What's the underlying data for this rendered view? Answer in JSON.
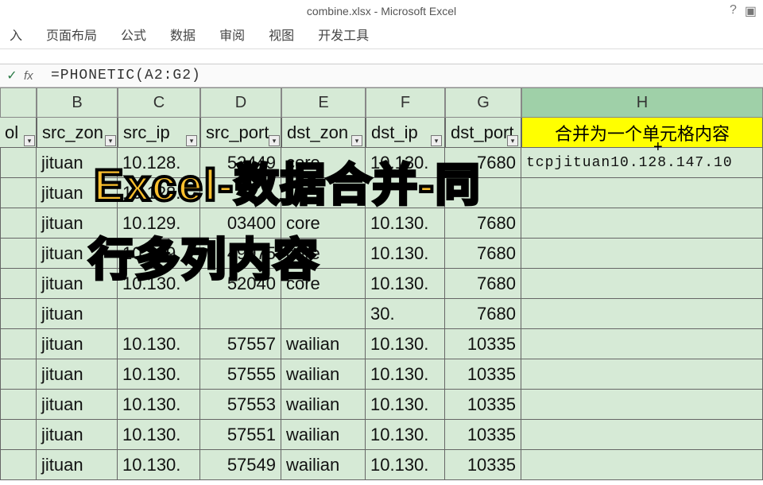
{
  "window": {
    "title": "combine.xlsx - Microsoft Excel"
  },
  "ribbon": {
    "tabs": [
      "入",
      "页面布局",
      "公式",
      "数据",
      "审阅",
      "视图",
      "开发工具"
    ]
  },
  "formula_bar": {
    "fx": "fx",
    "formula": "=PHONETIC(A2:G2)"
  },
  "columns": [
    "B",
    "C",
    "D",
    "E",
    "F",
    "G",
    "H"
  ],
  "headers": {
    "A": "ol",
    "B": "src_zon",
    "C": "src_ip",
    "D": "src_port",
    "E": "dst_zon",
    "F": "dst_ip",
    "G": "dst_port",
    "H": "合并为一个单元格内容"
  },
  "rows": [
    {
      "B": "jituan",
      "C": "10.128.",
      "D": "52449",
      "E": "core",
      "F": "10.130.",
      "G": "7680",
      "H": "tcpjituan10.128.147.10"
    },
    {
      "B": "jituan",
      "C": "10.128.",
      "D": "",
      "E": "",
      "F": "",
      "G": "",
      "H": ""
    },
    {
      "B": "jituan",
      "C": "10.129.",
      "D": "03400",
      "E": "core",
      "F": "10.130.",
      "G": "7680",
      "H": ""
    },
    {
      "B": "jituan",
      "C": "10.129.",
      "D": "49975",
      "E": "core",
      "F": "10.130.",
      "G": "7680",
      "H": ""
    },
    {
      "B": "jituan",
      "C": "10.130.",
      "D": "52040",
      "E": "core",
      "F": "10.130.",
      "G": "7680",
      "H": ""
    },
    {
      "B": "jituan",
      "C": "",
      "D": "",
      "E": "",
      "F": "30.",
      "G": "7680",
      "H": ""
    },
    {
      "B": "jituan",
      "C": "10.130.",
      "D": "57557",
      "E": "wailian",
      "F": "10.130.",
      "G": "10335",
      "H": ""
    },
    {
      "B": "jituan",
      "C": "10.130.",
      "D": "57555",
      "E": "wailian",
      "F": "10.130.",
      "G": "10335",
      "H": ""
    },
    {
      "B": "jituan",
      "C": "10.130.",
      "D": "57553",
      "E": "wailian",
      "F": "10.130.",
      "G": "10335",
      "H": ""
    },
    {
      "B": "jituan",
      "C": "10.130.",
      "D": "57551",
      "E": "wailian",
      "F": "10.130.",
      "G": "10335",
      "H": ""
    },
    {
      "B": "jituan",
      "C": "10.130.",
      "D": "57549",
      "E": "wailian",
      "F": "10.130.",
      "G": "10335",
      "H": ""
    }
  ],
  "overlay": {
    "line1": "Excel-数据合并-同",
    "line2": "行多列内容"
  }
}
